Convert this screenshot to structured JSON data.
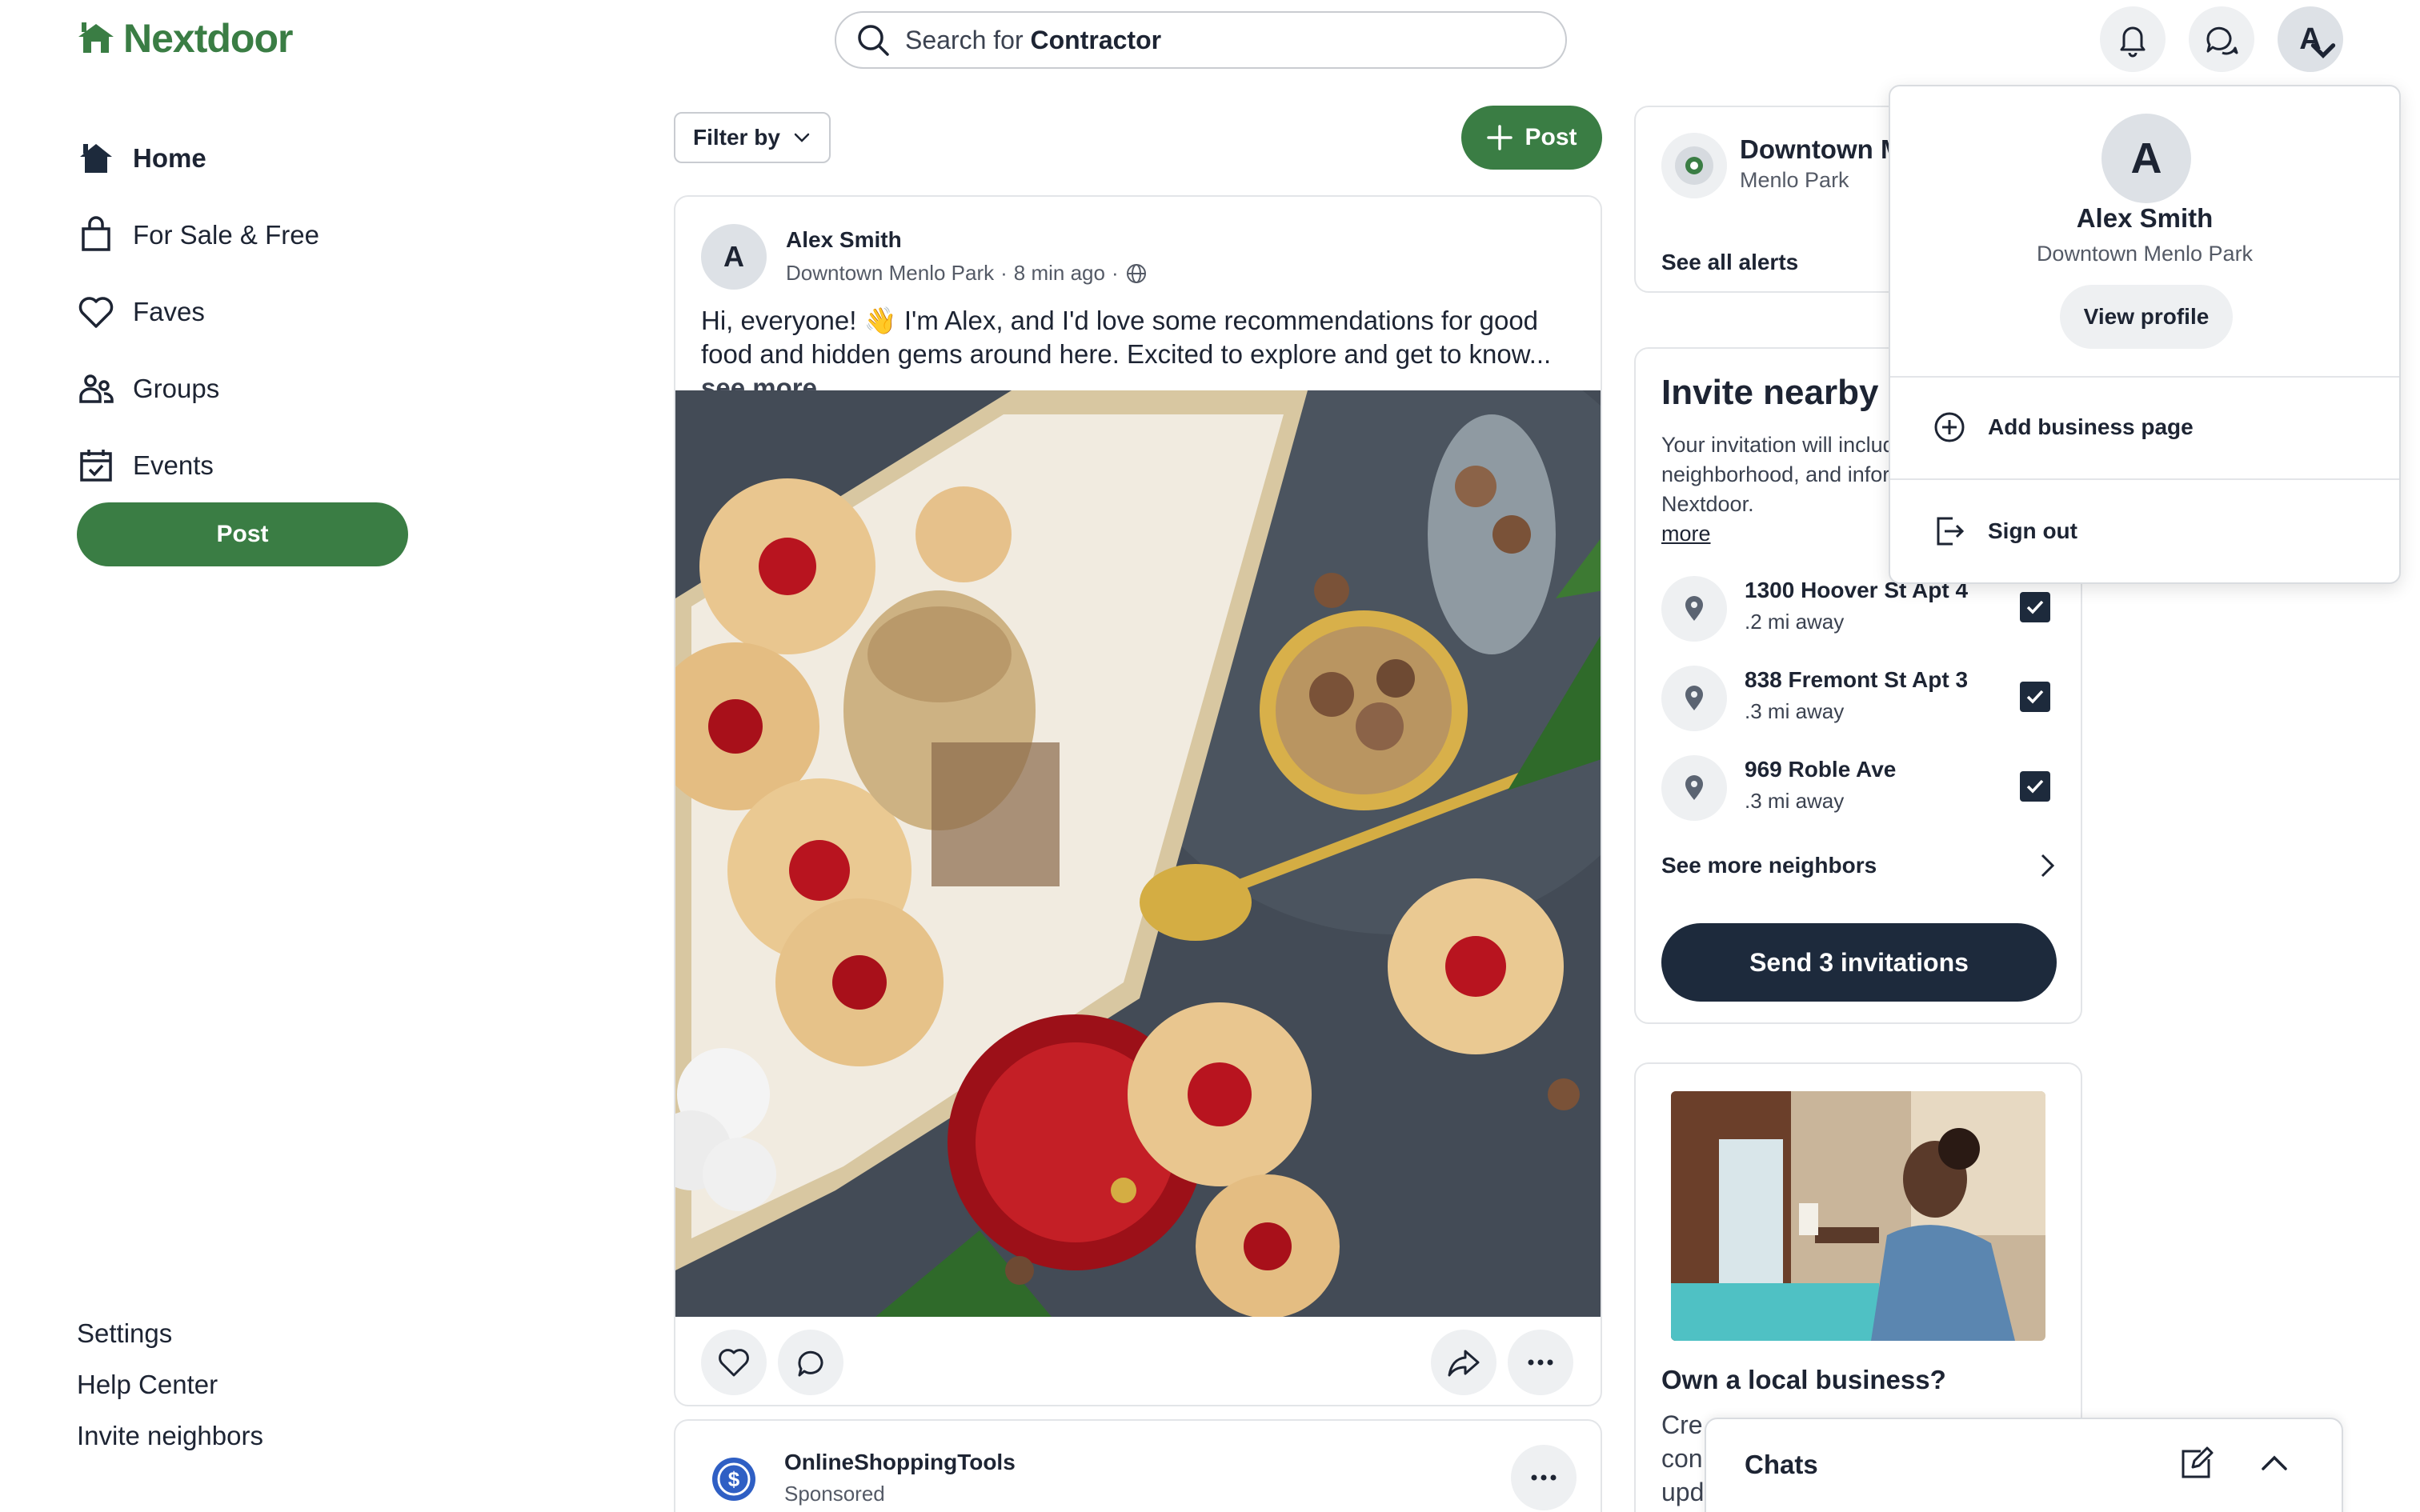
{
  "header": {
    "logo_text": "Nextdoor",
    "search_prefix": "Search for",
    "search_term": "Contractor",
    "avatar_initial": "A"
  },
  "nav": {
    "items": [
      {
        "label": "Home",
        "icon": "home-icon",
        "active": true
      },
      {
        "label": "For Sale & Free",
        "icon": "shopping-bag-icon"
      },
      {
        "label": "Faves",
        "icon": "heart-icon"
      },
      {
        "label": "Groups",
        "icon": "groups-icon"
      },
      {
        "label": "Events",
        "icon": "calendar-icon"
      }
    ],
    "post_label": "Post",
    "footer_links": [
      "Settings",
      "Help Center",
      "Invite neighbors"
    ]
  },
  "feed": {
    "filter_label": "Filter by",
    "post_label": "Post",
    "post": {
      "avatar_initial": "A",
      "author": "Alex Smith",
      "neighborhood": "Downtown Menlo Park",
      "time": "8 min ago",
      "body": "Hi, everyone! 👋 I'm Alex, and I'd love some recommendations for good food and hidden gems around here. Excited to explore and get to know...",
      "see_more": "see more"
    },
    "ad": {
      "name": "OnlineShoppingTools",
      "sub": "Sponsored"
    }
  },
  "right": {
    "alerts": {
      "title": "Downtown Menlo Park",
      "sub": "Menlo Park",
      "link": "See all alerts"
    },
    "invite": {
      "title": "Invite nearby neighbors",
      "desc": "Your invitation will include your name, your neighborhood, and information about Nextdoor.",
      "learn_more": "more",
      "neighbors": [
        {
          "address": "1300 Hoover St Apt 4",
          "distance": ".2 mi away",
          "checked": true
        },
        {
          "address": "838 Fremont St Apt 3",
          "distance": ".3 mi away",
          "checked": true
        },
        {
          "address": "969 Roble Ave",
          "distance": ".3 mi away",
          "checked": true
        }
      ],
      "see_more": "See more neighbors",
      "send_label": "Send 3 invitations"
    },
    "business": {
      "title": "Own a local business?",
      "desc_lines": [
        "Cre",
        "con",
        "upd"
      ]
    }
  },
  "dropdown": {
    "avatar_initial": "A",
    "name": "Alex Smith",
    "location": "Downtown Menlo Park",
    "view_profile": "View profile",
    "add_business": "Add business page",
    "sign_out": "Sign out"
  },
  "chats": {
    "label": "Chats"
  },
  "colors": {
    "brand_green": "#3a7d44",
    "dark_navy": "#1d2a3c",
    "muted_text": "#545a66"
  }
}
